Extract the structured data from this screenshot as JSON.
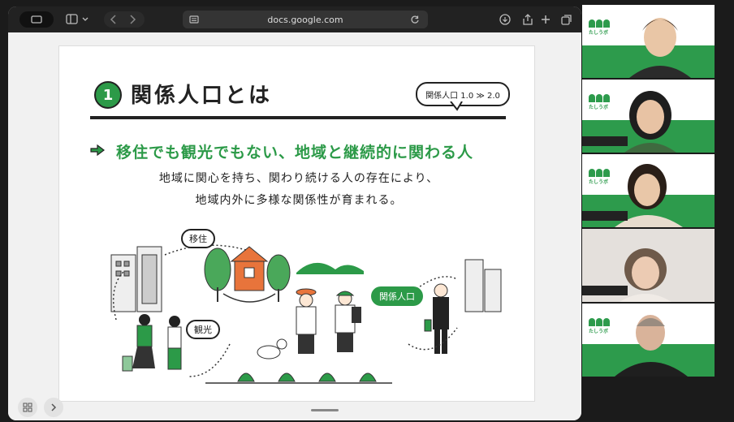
{
  "browser": {
    "url": "docs.google.com"
  },
  "slide": {
    "number": "1",
    "title": "関係人口とは",
    "badge": "関係人口 1.0 ≫ 2.0",
    "subtitle": "移住でも観光でもない、地域と継続的に関わる人",
    "desc_line1": "地域に関心を持ち、関わり続ける人の存在により、",
    "desc_line2": "地域内外に多様な関係性が育まれる。",
    "labels": {
      "iju": "移住",
      "kanko": "観光",
      "kankei": "関係人口"
    }
  },
  "participants": [
    {
      "logo_text": "たしうボ"
    },
    {
      "logo_text": "たしうボ"
    },
    {
      "logo_text": "たしうボ"
    },
    {
      "logo_text": ""
    },
    {
      "logo_text": "たしうボ"
    }
  ],
  "colors": {
    "accent_green": "#2c9a48",
    "browser_toolbar": "#222222"
  }
}
